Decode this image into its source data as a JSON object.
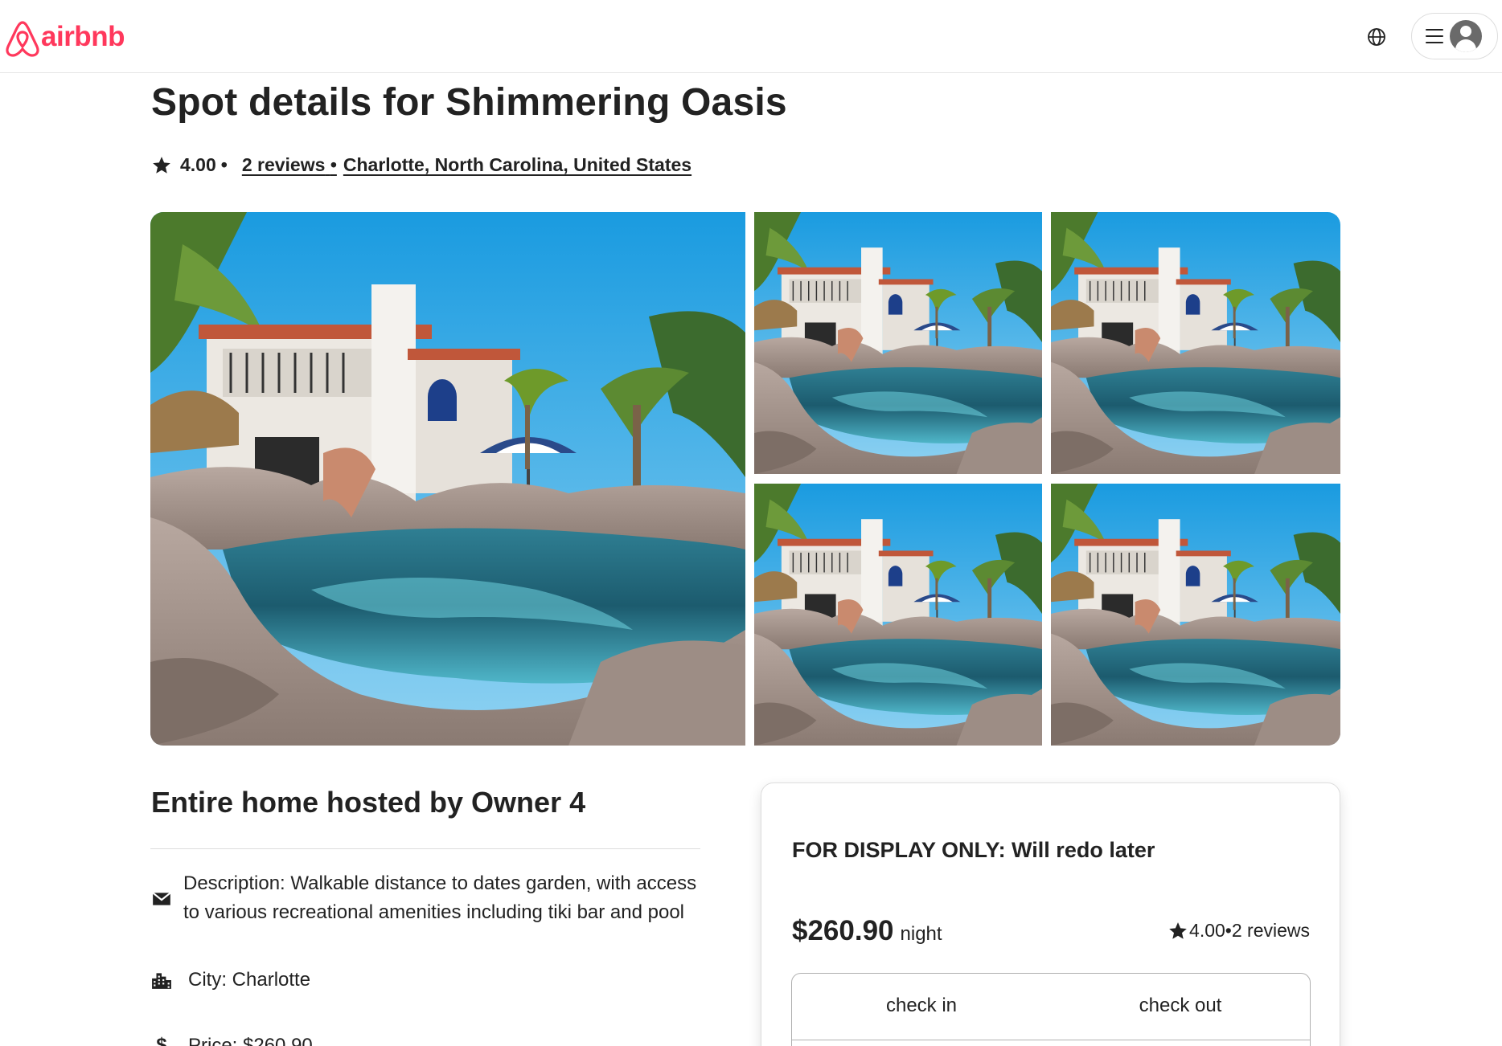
{
  "header": {
    "brand": "airbnb",
    "brand_color": "#ff385c",
    "icons": [
      "airbnb-logo-icon",
      "globe-icon",
      "hamburger-menu-icon",
      "user-avatar-icon"
    ]
  },
  "listing": {
    "title": "Spot details for Shimmering Oasis",
    "rating": "4.00",
    "separator": "•",
    "reviews_link": "2 reviews",
    "location": "Charlotte, North Carolina, United States"
  },
  "gallery": {
    "photos": [
      "pool-house-photo",
      "pool-house-photo",
      "pool-house-photo",
      "pool-house-photo",
      "pool-house-photo"
    ]
  },
  "details": {
    "host_title": "Entire home hosted by Owner 4",
    "description": "Description: Walkable distance to dates garden, with access to various recreational amenities including tiki bar and pool",
    "city": "City: Charlotte",
    "price": "Price: $260.90"
  },
  "booking": {
    "note": "FOR DISPLAY ONLY: Will redo later",
    "price": "$260.90",
    "unit": "night",
    "rating": "4.00",
    "reviews": "•2 reviews",
    "check_in": "check in",
    "check_out": "check out"
  }
}
